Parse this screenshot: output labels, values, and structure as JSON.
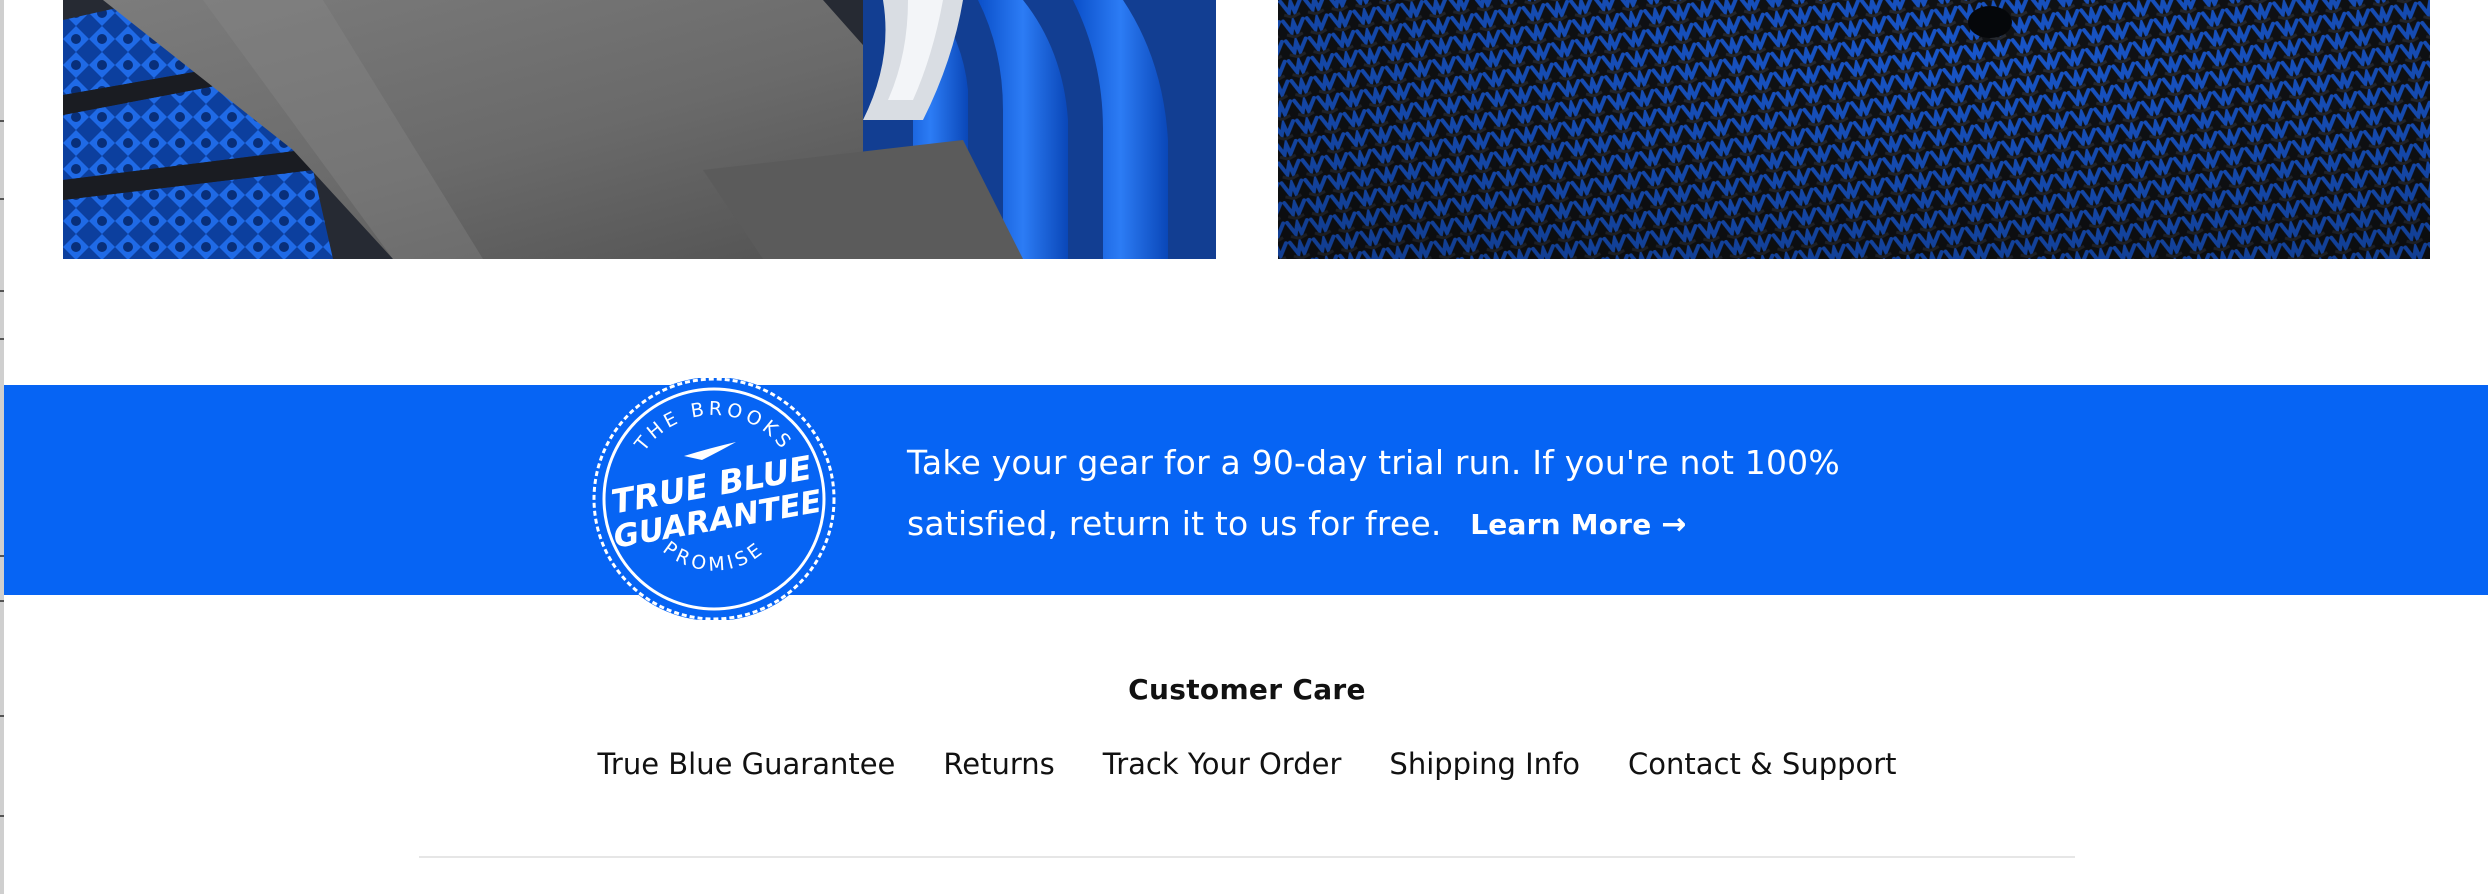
{
  "colors": {
    "brand_blue": "#0664f4",
    "text_dark": "#111111",
    "divider": "#e6e6e6"
  },
  "images": {
    "left": {
      "icon": "shoe-detail-photo"
    },
    "right": {
      "icon": "knit-fabric-photo"
    }
  },
  "guarantee": {
    "seal": {
      "arc_top": "THE BROOKS",
      "title_line1": "TRUE BLUE",
      "title_line2": "GUARANTEE",
      "arc_bottom": "PROMISE"
    },
    "text_line1": "Take your gear for a 90-day trial run. If you're not 100%",
    "text_line2": "satisfied, return it to us for free.",
    "learn_more_label": "Learn More",
    "learn_more_arrow": "→"
  },
  "footer": {
    "heading": "Customer Care",
    "links": [
      "True Blue Guarantee",
      "Returns",
      "Track Your Order",
      "Shipping Info",
      "Contact & Support"
    ]
  }
}
